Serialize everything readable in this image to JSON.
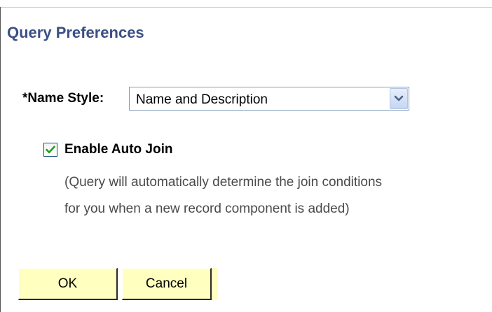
{
  "page": {
    "title": "Query Preferences"
  },
  "name_style": {
    "label": "*Name Style:",
    "selected": "Name and Description",
    "icon": "chevron-down-icon"
  },
  "auto_join": {
    "label": "Enable Auto Join",
    "checked": true,
    "help_lines": [
      "(Query will automatically determine the join conditions",
      "for you when a new record component is added)"
    ]
  },
  "buttons": {
    "ok_label": "OK",
    "cancel_label": "Cancel"
  },
  "colors": {
    "title": "#3b4f86",
    "button_bg": "#ffffc0",
    "checkmark": "#22a022",
    "select_border": "#7f9db9"
  }
}
